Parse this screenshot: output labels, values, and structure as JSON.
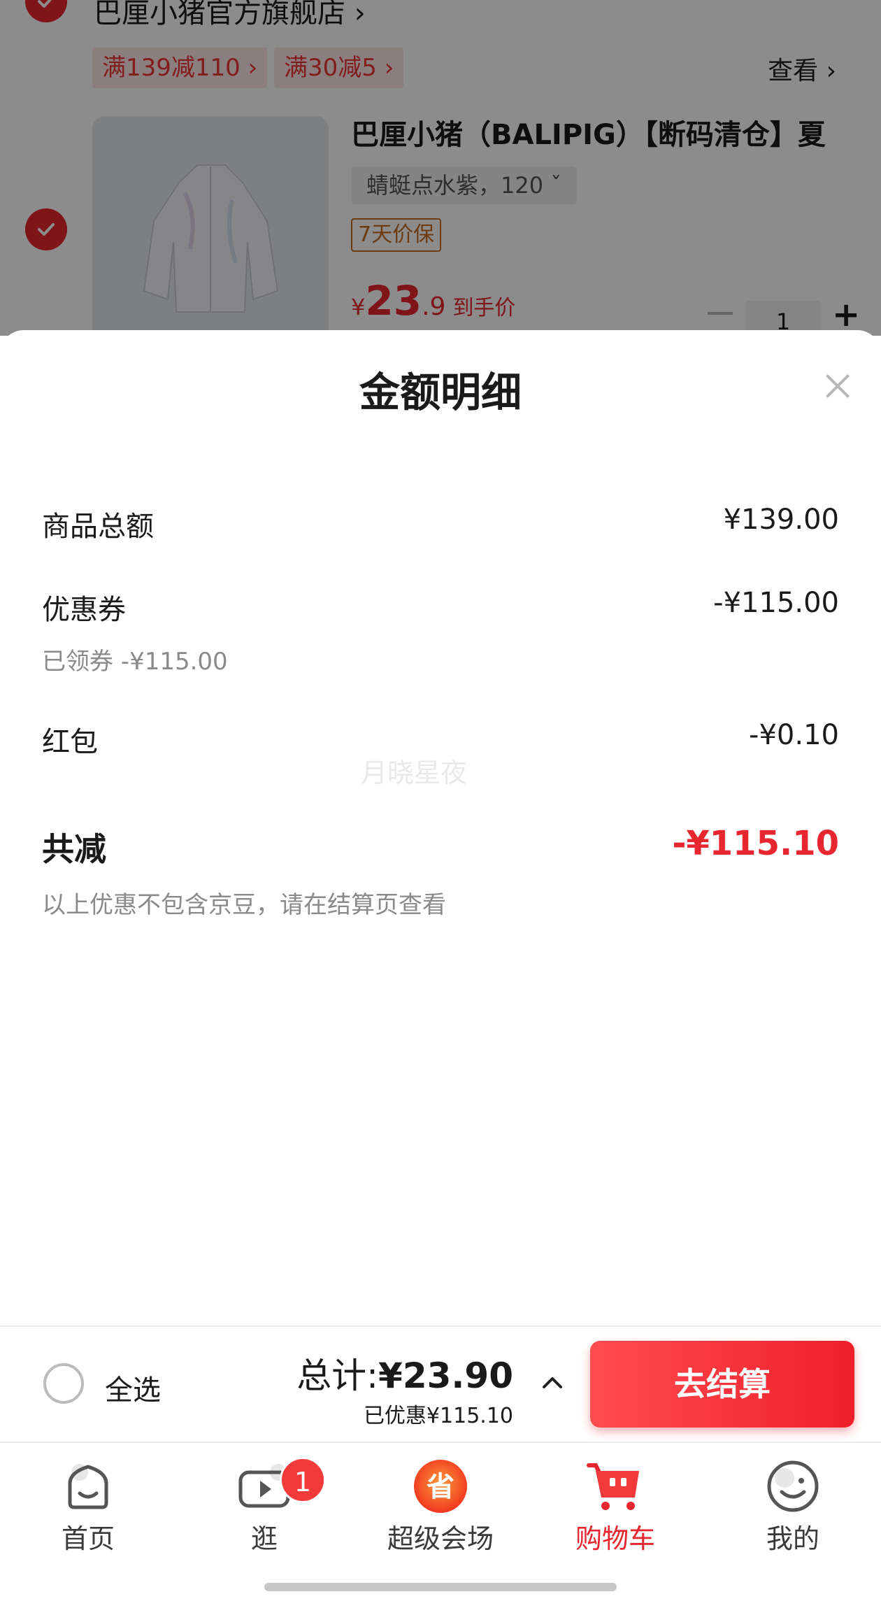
{
  "colors": {
    "accent_red": "#e8262f",
    "checkout_gradient_start": "#ff4d4f",
    "checkout_gradient_end": "#f01f2a",
    "muted_text": "#8a8a8a",
    "guarantee_orange": "#c96b1c"
  },
  "cart_background": {
    "store_name": "巴厘小猪官方旗舰店 ›",
    "promos": [
      "满139减110 ›",
      "满30减5 ›"
    ],
    "view_link": "查看 ›",
    "product_title": "巴厘小猪（BALIPIG）【断码清仓】夏",
    "spec": "蜻蜓点水紫，120  ˇ",
    "guarantee": "7天价保",
    "price_currency": "¥",
    "price_int": "23",
    "price_dec": ".9",
    "price_label": "到手价",
    "quantity": "1"
  },
  "sheet": {
    "title": "金额明细",
    "rows": [
      {
        "label": "商品总额",
        "value": "¥139.00"
      },
      {
        "label": "优惠券",
        "value": "-¥115.00",
        "sub": "已领券 -¥115.00"
      },
      {
        "label": "红包",
        "value": "-¥0.10"
      }
    ],
    "watermark": "月晓星夜",
    "total_label": "共减",
    "total_value": "-¥115.10",
    "note": "以上优惠不包含京豆，请在结算页查看"
  },
  "checkout_bar": {
    "select_all": "全选",
    "total_prefix": "总计:",
    "total_amount": "¥23.90",
    "saved": "已优惠¥115.10",
    "checkout_button": "去结算"
  },
  "tab_bar": {
    "tabs": [
      {
        "label": "首页",
        "icon": "home-icon"
      },
      {
        "label": "逛",
        "icon": "video-icon",
        "badge": "1"
      },
      {
        "label": "超级会场",
        "icon": "super-venue-icon"
      },
      {
        "label": "购物车",
        "icon": "cart-icon",
        "active": true
      },
      {
        "label": "我的",
        "icon": "profile-icon"
      }
    ]
  }
}
